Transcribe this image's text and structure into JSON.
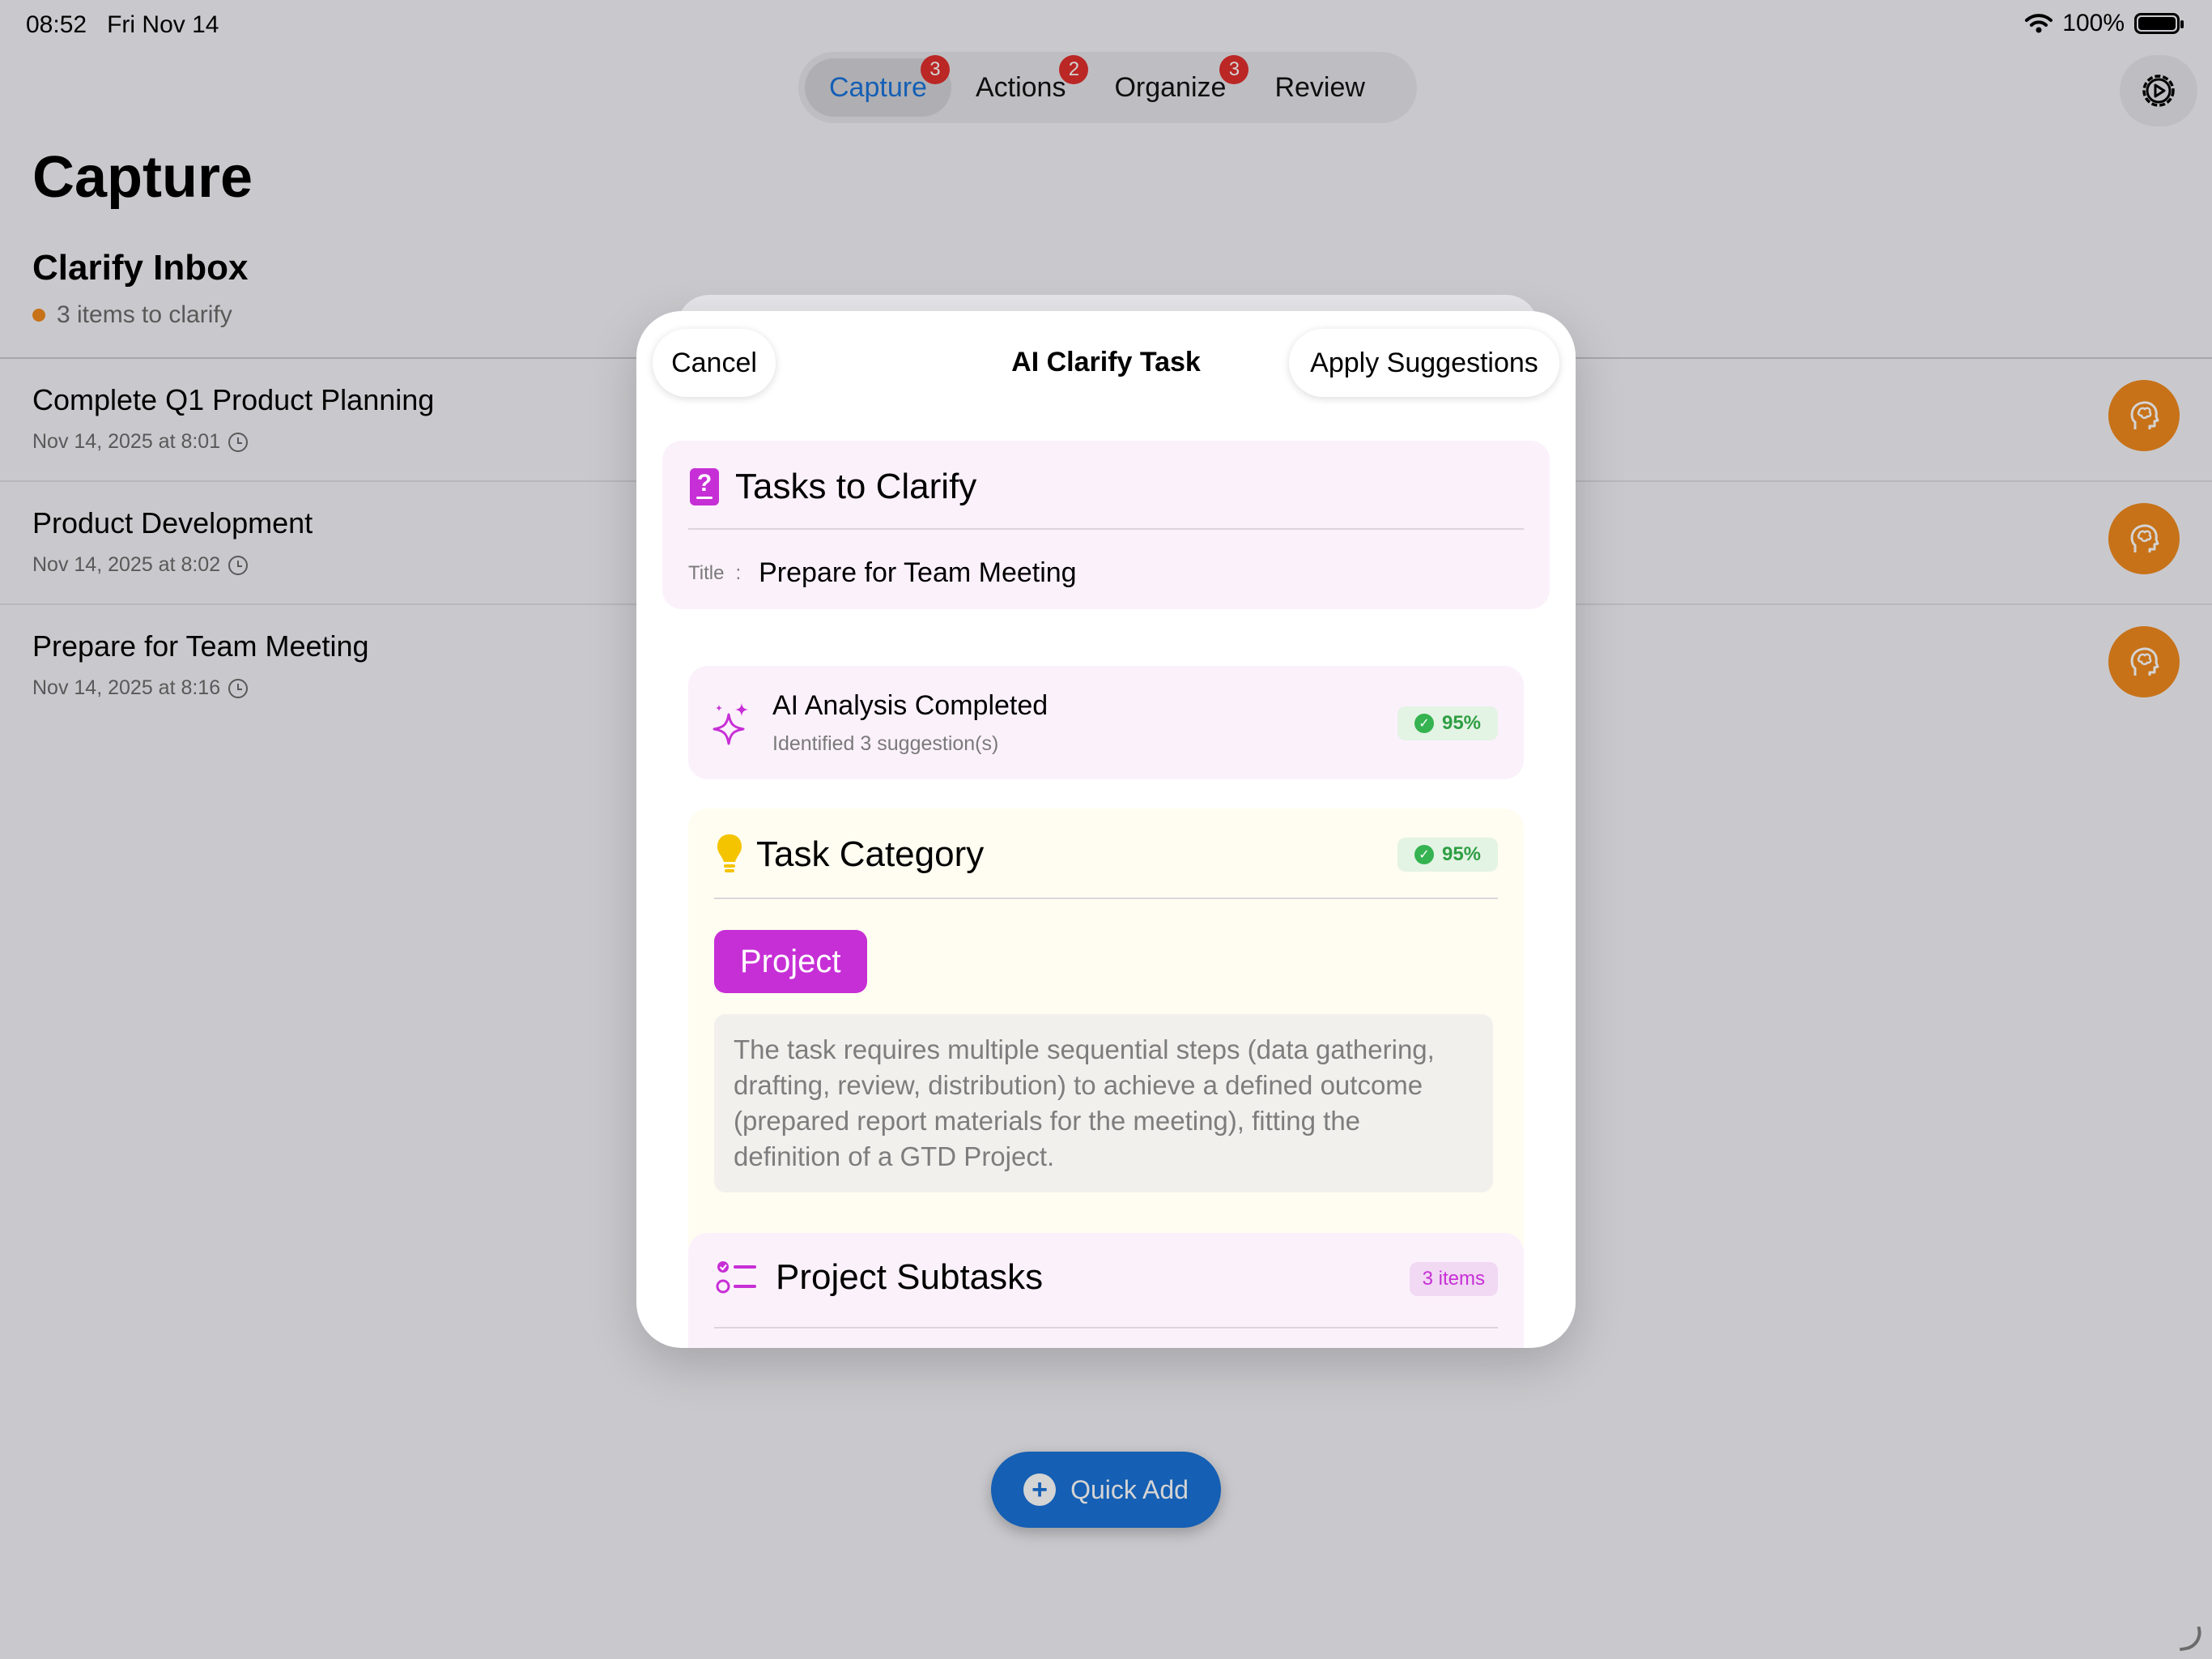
{
  "status_bar": {
    "time": "08:52",
    "date": "Fri Nov 14",
    "battery": "100%"
  },
  "tabs": [
    {
      "label": "Capture",
      "badge": "3",
      "active": true
    },
    {
      "label": "Actions",
      "badge": "2"
    },
    {
      "label": "Organize",
      "badge": "3"
    },
    {
      "label": "Review",
      "badge": ""
    }
  ],
  "page": {
    "title": "Capture",
    "section_title": "Clarify Inbox",
    "section_subtitle": "3 items to clarify"
  },
  "inbox": [
    {
      "title": "Complete Q1 Product Planning",
      "date": "Nov 14, 2025 at 8:01"
    },
    {
      "title": "Product Development",
      "date": "Nov 14, 2025 at 8:02"
    },
    {
      "title": "Prepare for Team Meeting",
      "date": "Nov 14, 2025 at 8:16"
    }
  ],
  "quick_add": {
    "label": "Quick Add"
  },
  "sheet": {
    "cancel_label": "Cancel",
    "title": "AI Clarify Task",
    "apply_label": "Apply Suggestions",
    "clarify": {
      "heading": "Tasks to Clarify",
      "title_label": "Title",
      "separator": ":",
      "title_value": "Prepare for Team Meeting"
    },
    "analysis": {
      "title": "AI Analysis Completed",
      "subtitle": "Identified 3 suggestion(s)",
      "confidence": "95%"
    },
    "category": {
      "heading": "Task Category",
      "confidence": "95%",
      "tag": "Project",
      "reason": "The task requires multiple sequential steps (data gathering, drafting, review, distribution) to achieve a defined outcome (prepared report materials for the meeting), fitting the definition of a GTD Project."
    },
    "subtasks": {
      "heading": "Project Subtasks",
      "count": "3 items"
    }
  },
  "colors": {
    "accent_blue": "#1a73d9",
    "brand_magenta": "#c72fd6",
    "badge_red": "#e0302d",
    "orange": "#f08a1d",
    "success_green": "#34b350"
  },
  "icons": {
    "settings": "gear-play-icon",
    "clarify_row": "brain-head-icon",
    "analysis": "sparkles-icon",
    "category": "lightbulb-icon",
    "subtasks": "checklist-icon",
    "clarify_heading": "question-doc-icon"
  }
}
